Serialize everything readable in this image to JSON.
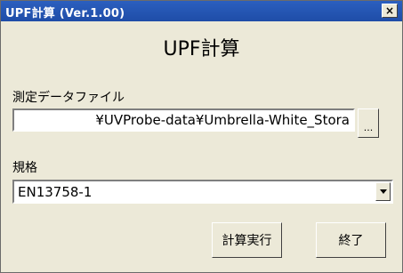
{
  "window": {
    "title": "UPF計算 (Ver.1.00)",
    "close_label": "×"
  },
  "main": {
    "heading": "UPF計算",
    "file_label": "測定データファイル",
    "file_value": "¥UVProbe-data¥Umbrella-White_Stora",
    "browse_label": "...",
    "standard_label": "規格",
    "standard_value": "EN13758-1"
  },
  "buttons": {
    "calc_label": "計算実行",
    "exit_label": "終了"
  },
  "colors": {
    "titlebar": "#1f4da8",
    "face": "#ece9d8"
  }
}
